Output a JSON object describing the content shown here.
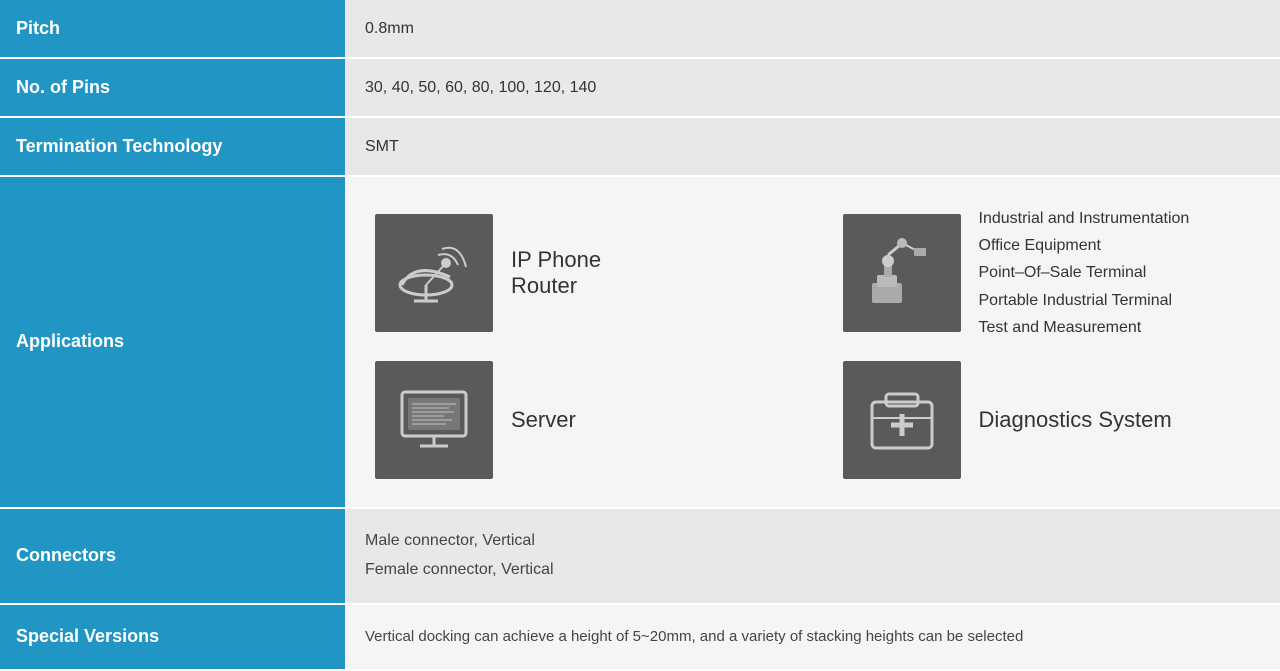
{
  "rows": {
    "pitch": {
      "label": "Pitch",
      "value": "0.8mm"
    },
    "no_of_pins": {
      "label": "No. of Pins",
      "value": "30, 40, 50, 60, 80, 100, 120, 140"
    },
    "termination": {
      "label": "Termination Technology",
      "value": "SMT"
    },
    "applications": {
      "label": "Applications",
      "items": [
        {
          "icon": "satellite",
          "label": "IP Phone\nRouter"
        },
        {
          "icon": "industrial",
          "label_multi": "Industrial and Instrumentation\nOffice Equipment\nPoint–Of–Sale Terminal\nPortable Industrial Terminal\nTest and Measurement"
        },
        {
          "icon": "server",
          "label": "Server"
        },
        {
          "icon": "diagnostics",
          "label": "Diagnostics System"
        }
      ]
    },
    "connectors": {
      "label": "Connectors",
      "value1": "Male connector, Vertical",
      "value2": "Female connector, Vertical"
    },
    "special_versions": {
      "label": "Special Versions",
      "value": "Vertical docking can achieve a height of 5~20mm, and a variety of stacking heights can be selected"
    }
  }
}
